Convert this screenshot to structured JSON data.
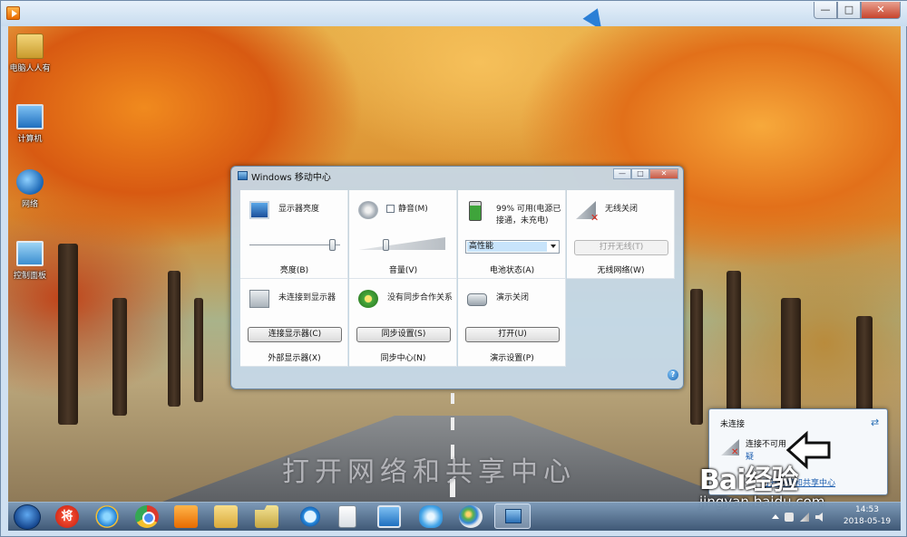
{
  "outer_window": {
    "buttons": {
      "minimize": "—",
      "maximize": "□",
      "close": "✕"
    }
  },
  "desktop": {
    "icons": [
      {
        "label": "电脑人人有",
        "icon": "user-folder-icon"
      },
      {
        "label": "计算机",
        "icon": "computer-icon"
      },
      {
        "label": "网络",
        "icon": "network-icon"
      },
      {
        "label": "控制面板",
        "icon": "control-panel-icon"
      }
    ],
    "caption": "打开网络和共享中心"
  },
  "mobility_center": {
    "title": "Windows 移动中心",
    "buttons": {
      "minimize": "—",
      "maximize": "□",
      "close": "✕"
    },
    "tiles": {
      "brightness": {
        "label": "显示器亮度",
        "footer": "亮度(B)",
        "level": 0.97
      },
      "volume": {
        "checkbox_label": "静音(M)",
        "footer": "音量(V)",
        "level": 0.3,
        "muted": false
      },
      "battery": {
        "label_line1": "99% 可用(电源已",
        "label_line2": "接通，未充电)",
        "selected_plan": "高性能",
        "footer": "电池状态(A)"
      },
      "wireless": {
        "label": "无线关闭",
        "button": "打开无线(T)",
        "footer": "无线网络(W)"
      },
      "external_display": {
        "label": "未连接到显示器",
        "button": "连接显示器(C)",
        "footer": "外部显示器(X)"
      },
      "sync": {
        "label": "没有同步合作关系",
        "button": "同步设置(S)",
        "footer": "同步中心(N)"
      },
      "presentation": {
        "label": "演示关闭",
        "button": "打开(U)",
        "footer": "演示设置(P)"
      }
    },
    "help_icon": "?"
  },
  "network_popup": {
    "title": "未连接",
    "refresh_icon": "⇄",
    "status": "连接不可用",
    "link_partial": "疑",
    "link_bottom": "打开网络和共享中心"
  },
  "watermark": {
    "logo": "Bai经验",
    "url": "jingyan.baidu.com"
  },
  "taskbar": {
    "apps": [
      "将",
      "ie",
      "chrome",
      "player",
      "explorer",
      "folder",
      "magnifier",
      "doc",
      "present",
      "puzzle",
      "paint",
      "mobility"
    ],
    "clock": {
      "time": "14:53",
      "date": "2018-05-19"
    }
  },
  "colors": {
    "link": "#1f5fb0",
    "wireless_off_x": "#d52b1e",
    "titlebar": "#c8dcef"
  }
}
